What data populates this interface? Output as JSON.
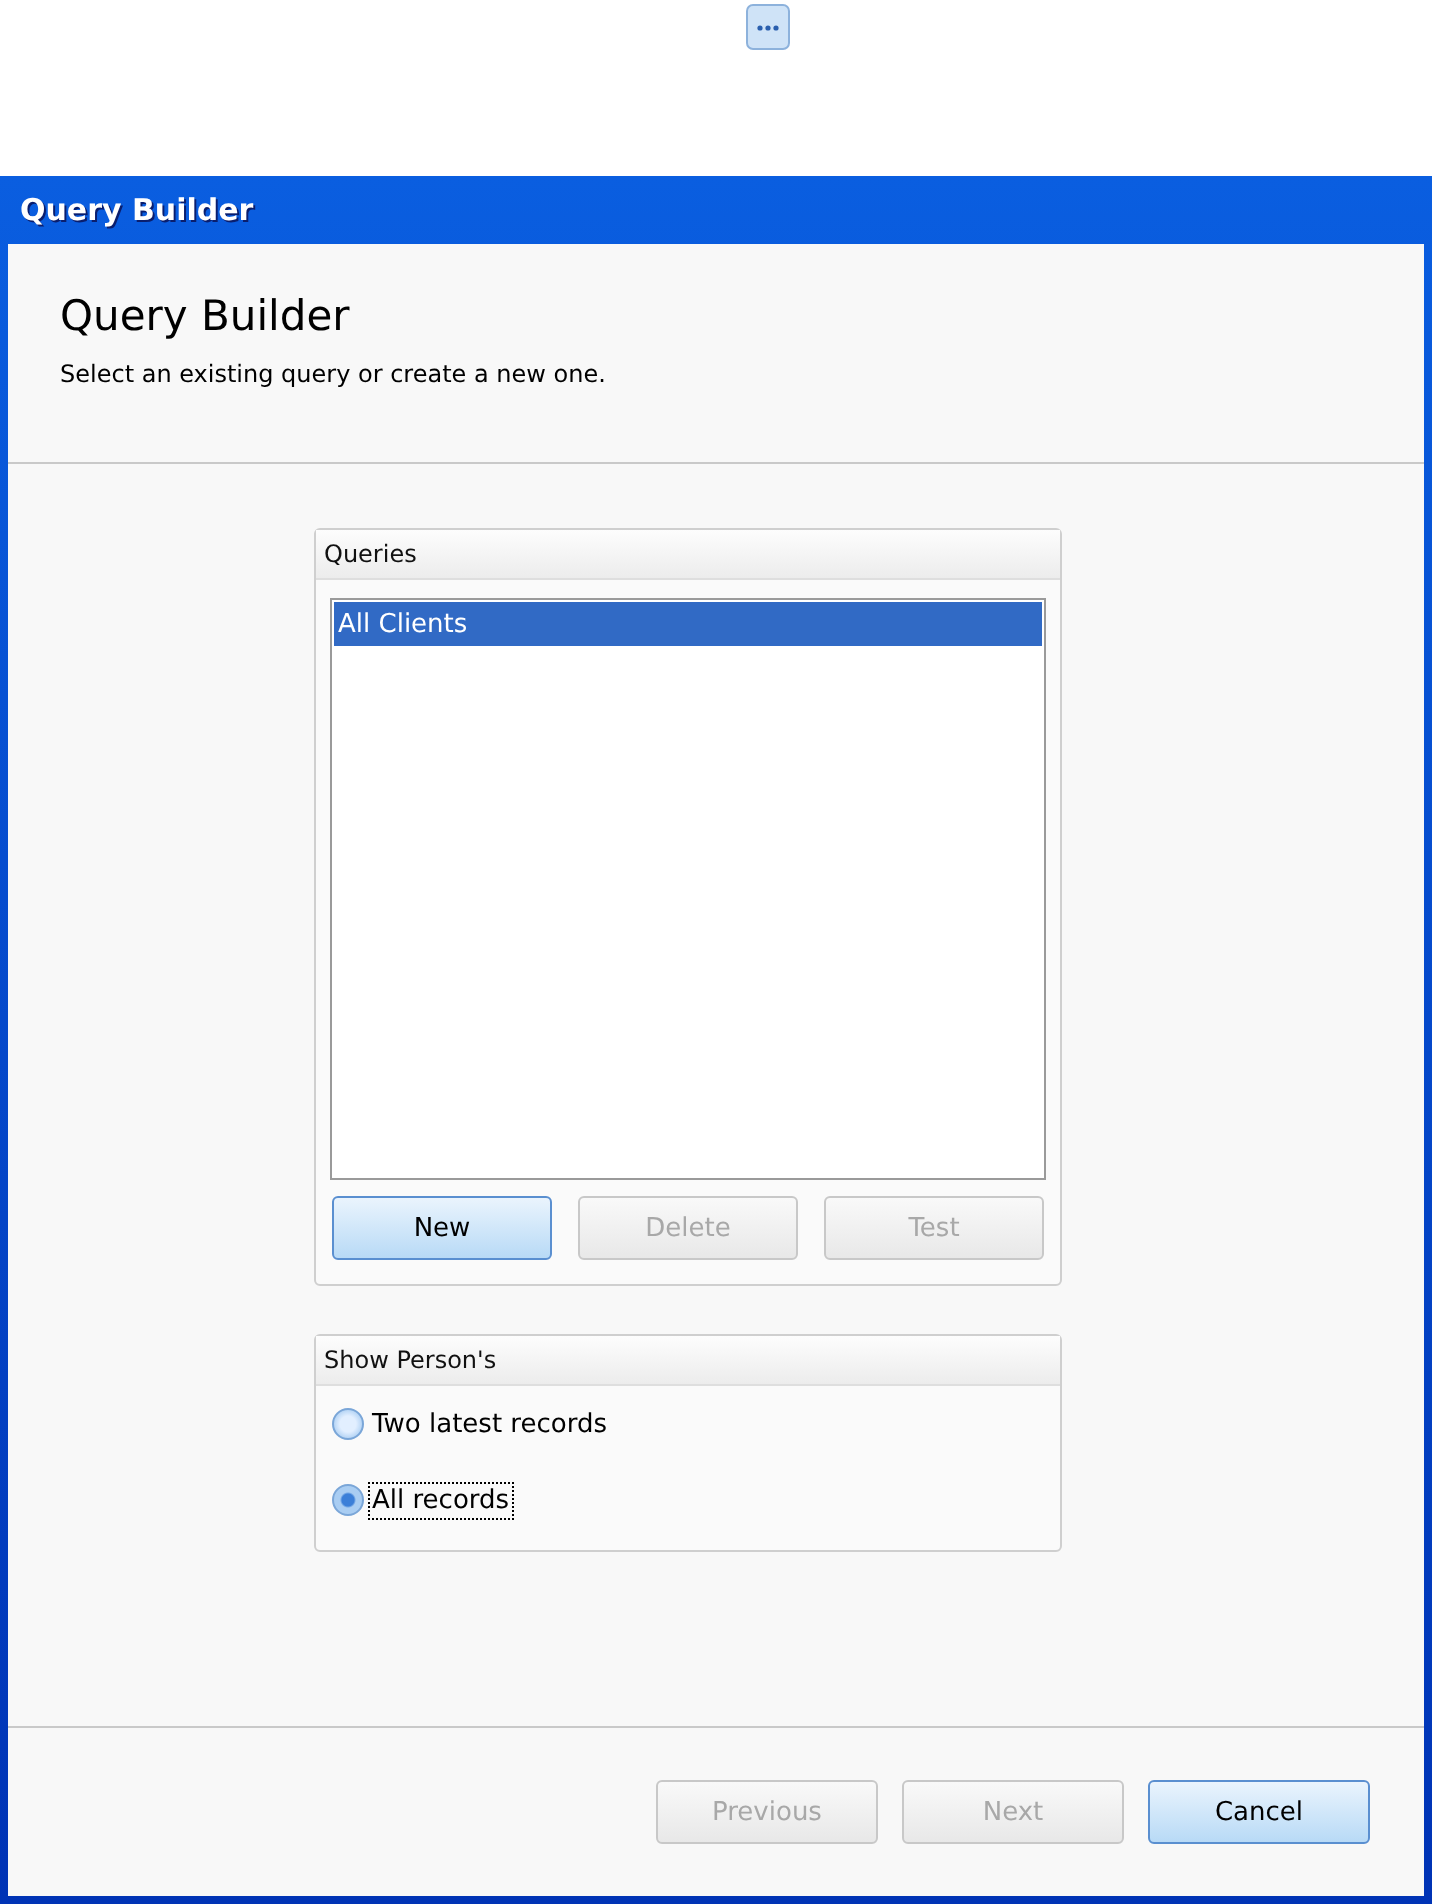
{
  "window": {
    "title": "Query Builder"
  },
  "header": {
    "title": "Query Builder",
    "subtitle": "Select an existing query or create a new one."
  },
  "queries": {
    "title": "Queries",
    "items": [
      {
        "label": "All Clients",
        "selected": true
      }
    ],
    "buttons": [
      {
        "label": "New",
        "disabled": false,
        "default": true
      },
      {
        "label": "Delete",
        "disabled": true,
        "default": false
      },
      {
        "label": "Test",
        "disabled": true,
        "default": false
      }
    ]
  },
  "show": {
    "title": "Show Person's",
    "options": [
      {
        "label": "Two latest records",
        "selected": false,
        "focused": false
      },
      {
        "label": "All records",
        "selected": true,
        "focused": true
      }
    ]
  },
  "footer": {
    "buttons": [
      {
        "label": "Previous",
        "disabled": true,
        "default": false
      },
      {
        "label": "Next",
        "disabled": true,
        "default": false
      },
      {
        "label": "Cancel",
        "disabled": false,
        "default": true
      }
    ]
  }
}
